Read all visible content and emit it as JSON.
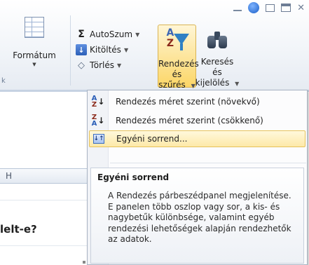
{
  "ribbon": {
    "format_label": "Formátum",
    "partial_group_label": "k",
    "autosum_label": "AutoSzum",
    "fill_label": "Kitöltés",
    "clear_label": "Törlés",
    "sort_filter_line1": "Rendezés",
    "sort_filter_line2": "és szűrés",
    "find_select_line1": "Keresés és",
    "find_select_line2": "kijelölés",
    "accent_color": "#fcd667"
  },
  "menu": {
    "items": [
      {
        "label": "Rendezés méret szerint (növekvő)",
        "icon": "sort-ascending-icon"
      },
      {
        "label": "Rendezés méret szerint (csökkenő)",
        "icon": "sort-descending-icon"
      },
      {
        "label": "Egyéni sorrend...",
        "icon": "custom-sort-icon",
        "highlighted": true
      }
    ],
    "sort_icon_top_letter": "A",
    "sort_icon_bottom_letter": "Z"
  },
  "tooltip": {
    "title": "Egyéni sorrend",
    "body": "A Rendezés párbeszédpanel megjelenítése. E panelen több oszlop vagy sor, a kis- és nagybetűk különbsége, valamint egyéb rendezési lehetőségek alapján rendezhetők az adatok."
  },
  "sheet": {
    "header_fragment": "H",
    "cell_text": "lelt-e?"
  }
}
